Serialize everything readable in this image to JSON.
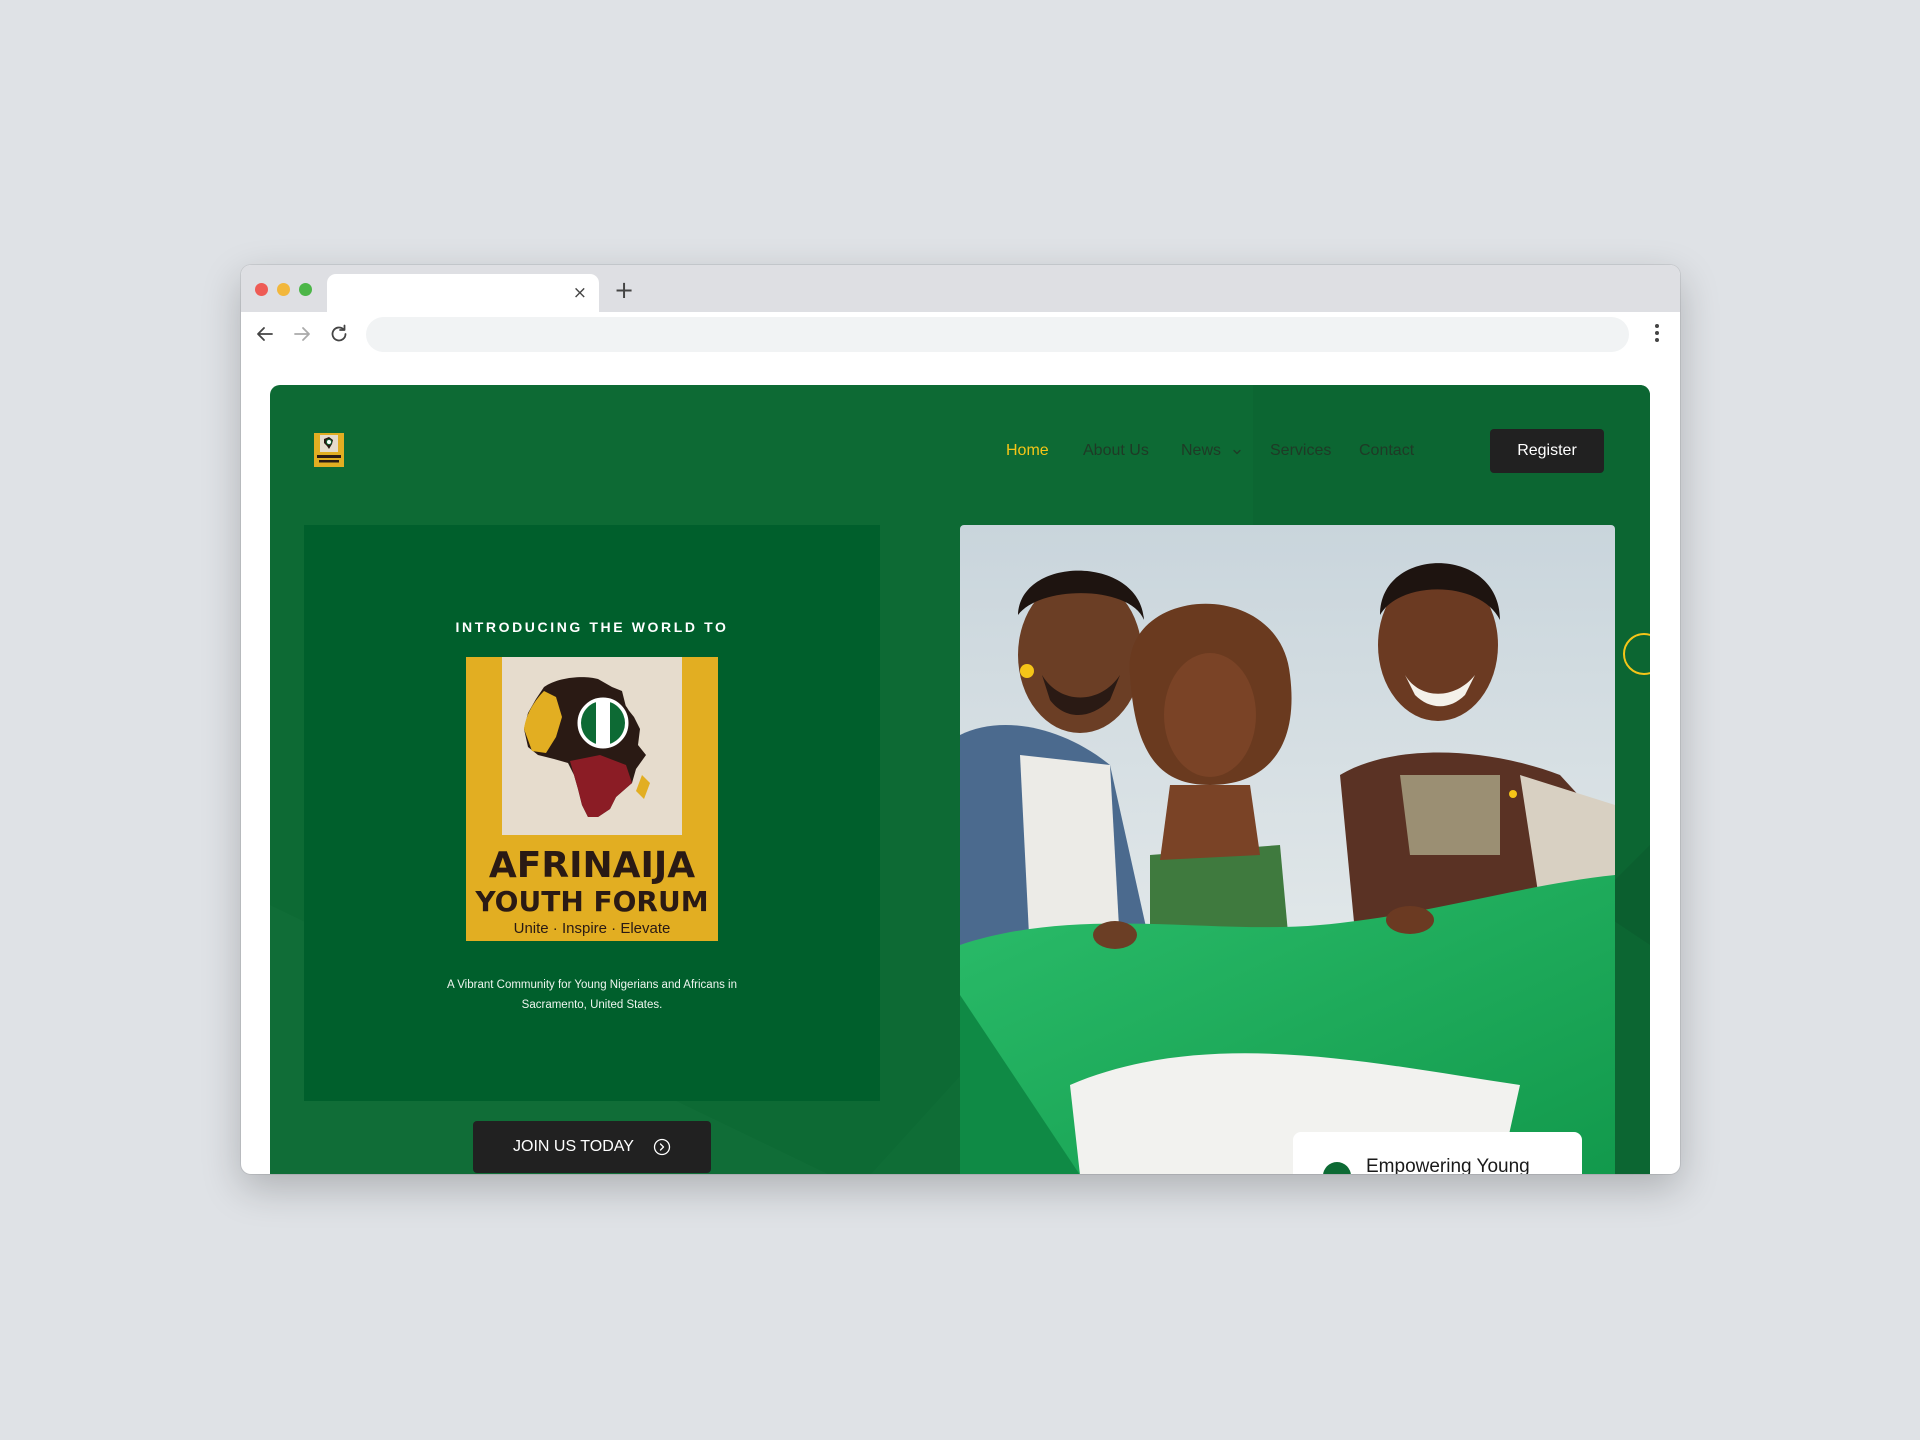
{
  "browser": {
    "tab_close": "×",
    "new_tab": "+"
  },
  "nav": {
    "items": [
      {
        "label": "Home",
        "active": true
      },
      {
        "label": "About Us",
        "active": false
      },
      {
        "label": "News",
        "active": false,
        "has_dropdown": true
      },
      {
        "label": "Services",
        "active": false
      },
      {
        "label": "Contact",
        "active": false
      }
    ],
    "register_label": "Register"
  },
  "hero": {
    "intro_heading": "INTRODUCING THE WORLD TO",
    "logo": {
      "name_line1": "AFRINAIJA",
      "name_line2": "YOUTH FORUM",
      "tagline": "Unite · Inspire · Elevate"
    },
    "description": "A Vibrant Community for Young Nigerians and Africans in Sacramento, United States.",
    "cta_label": "JOIN US TODAY",
    "feature_card_text": "Empowering Young"
  },
  "colors": {
    "brand_green": "#0d6a34",
    "dark_green": "#005f2c",
    "accent_yellow": "#f5c518",
    "button_dark": "#212121",
    "logo_gold": "#e2ae22",
    "logo_red": "#8b1c25"
  }
}
